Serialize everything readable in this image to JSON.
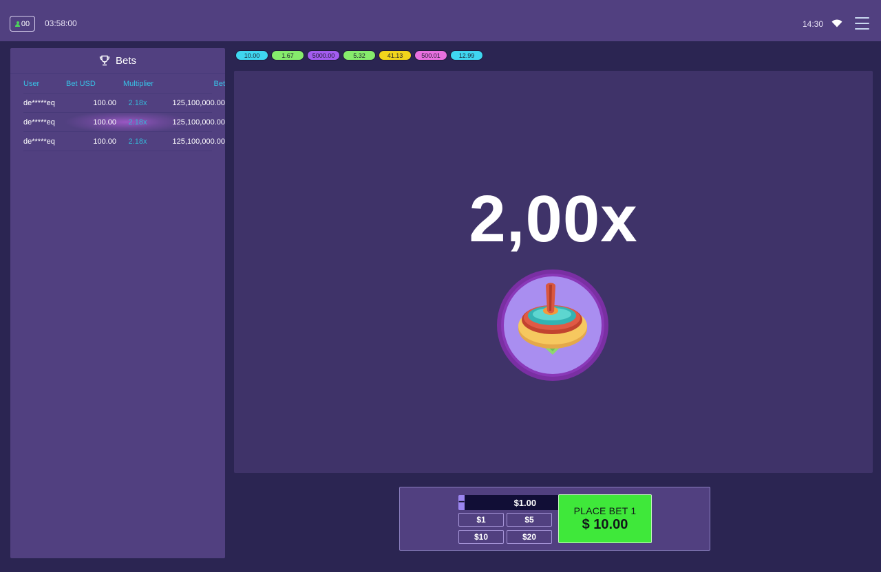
{
  "topbar": {
    "online_count": "00",
    "timer": "03:58:00",
    "clock": "14:30"
  },
  "bets_panel": {
    "title": "Bets",
    "columns": [
      "User",
      "Bet USD",
      "Multiplier",
      "Bet"
    ],
    "rows": [
      {
        "user": "de*****eq",
        "bet_usd": "100.00",
        "multiplier": "2.18x",
        "bet": "125,100,000.00"
      },
      {
        "user": "de*****eq",
        "bet_usd": "100.00",
        "multiplier": "2.18x",
        "bet": "125,100,000.00"
      },
      {
        "user": "de*****eq",
        "bet_usd": "100.00",
        "multiplier": "2.18x",
        "bet": "125,100,000.00"
      }
    ]
  },
  "history": [
    {
      "value": "10.00",
      "color": "#3fd6f0"
    },
    {
      "value": "1.67",
      "color": "#86ec6c"
    },
    {
      "value": "5000.00",
      "color": "#a35cf0"
    },
    {
      "value": "5.32",
      "color": "#86ec6c"
    },
    {
      "value": "41.13",
      "color": "#f2d51c"
    },
    {
      "value": "500.01",
      "color": "#e870e0"
    },
    {
      "value": "12.99",
      "color": "#3fd6f0"
    }
  ],
  "game": {
    "multiplier": "2,00x"
  },
  "controls": {
    "bet_value": "$1.00",
    "minus_label": "−",
    "plus_label": "+",
    "quick_bets": [
      "$1",
      "$5",
      "$10",
      "$20"
    ],
    "place_bet_label": "PLACE BET 1",
    "place_bet_amount": "$ 10.00"
  },
  "colors": {
    "background": "#2b2552",
    "panel": "#514080",
    "stage": "#3f3369",
    "accent_cyan": "#38c2e6",
    "place_bet_green": "#3fe83a"
  }
}
